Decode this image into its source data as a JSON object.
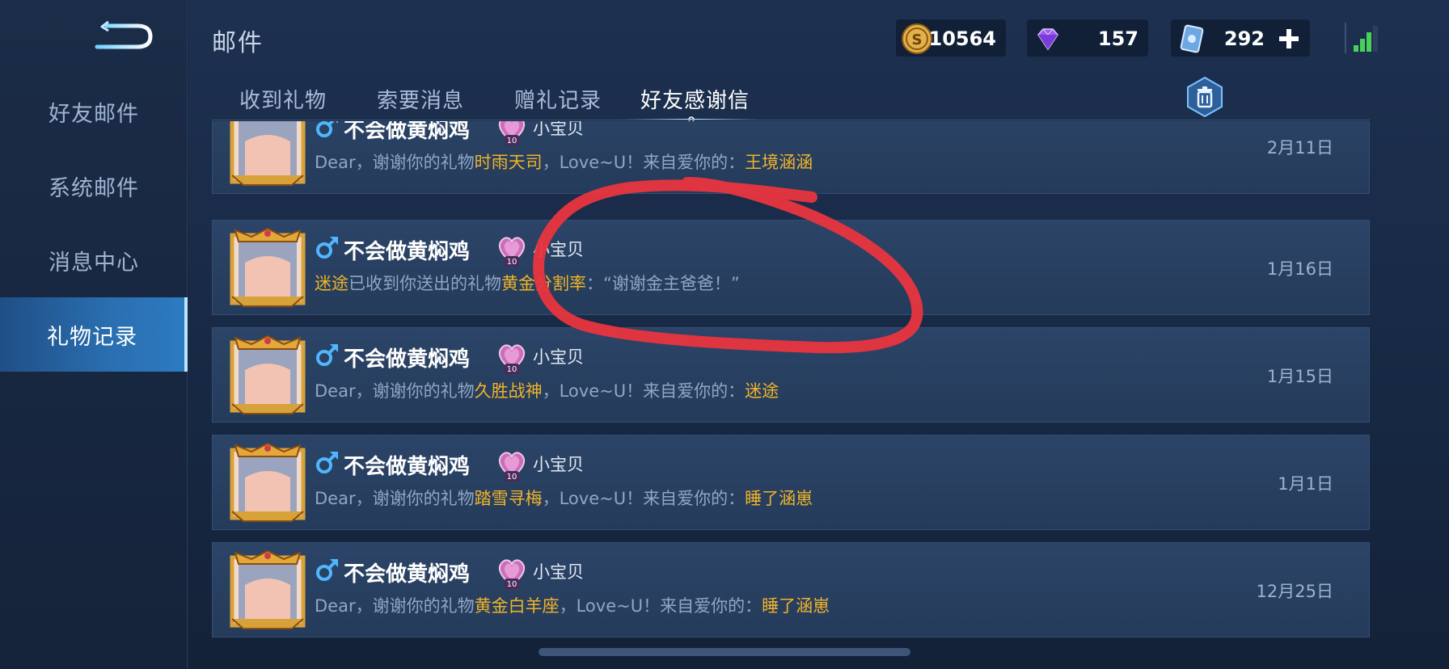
{
  "app": {
    "title": "邮件"
  },
  "sidebar": {
    "items": [
      {
        "label": "好友邮件",
        "active": false
      },
      {
        "label": "系统邮件",
        "active": false
      },
      {
        "label": "消息中心",
        "active": false
      },
      {
        "label": "礼物记录",
        "active": true
      }
    ]
  },
  "currencies": {
    "gold": {
      "icon": "gold-coin-icon",
      "value": "10564"
    },
    "diamond": {
      "icon": "purple-diamond-icon",
      "value": "157"
    },
    "card": {
      "icon": "blue-card-icon",
      "value": "292",
      "add_icon": "plus-icon"
    }
  },
  "tabs": [
    {
      "label": "收到礼物",
      "active": false
    },
    {
      "label": "索要消息",
      "active": false
    },
    {
      "label": "赠礼记录",
      "active": false
    },
    {
      "label": "好友感谢信",
      "active": true
    }
  ],
  "colors": {
    "highlight": "#f0b429",
    "active_nav": "#2a6fb0",
    "annotation": "#e8353f"
  },
  "messages": [
    {
      "sender": "不会做黄焖鸡",
      "relation_level": "10",
      "relation": "小宝贝",
      "parts": [
        {
          "text": "Dear，谢谢你的礼物",
          "hl": false
        },
        {
          "text": "时雨天司",
          "hl": true
        },
        {
          "text": "，Love~U！来自爱你的：",
          "hl": false
        },
        {
          "text": "王境涵涵",
          "hl": true
        }
      ],
      "date": "2月11日"
    },
    {
      "sender": "不会做黄焖鸡",
      "relation_level": "10",
      "relation": "小宝贝",
      "parts": [
        {
          "text": "迷途",
          "hl": true
        },
        {
          "text": "已收到你送出的礼物",
          "hl": false
        },
        {
          "text": "黄金分割率",
          "hl": true
        },
        {
          "text": "：“谢谢金主爸爸！”",
          "hl": false
        }
      ],
      "date": "1月16日"
    },
    {
      "sender": "不会做黄焖鸡",
      "relation_level": "10",
      "relation": "小宝贝",
      "parts": [
        {
          "text": "Dear，谢谢你的礼物",
          "hl": false
        },
        {
          "text": "久胜战神",
          "hl": true
        },
        {
          "text": "，Love~U！来自爱你的：",
          "hl": false
        },
        {
          "text": "迷途",
          "hl": true
        }
      ],
      "date": "1月15日"
    },
    {
      "sender": "不会做黄焖鸡",
      "relation_level": "10",
      "relation": "小宝贝",
      "parts": [
        {
          "text": "Dear，谢谢你的礼物",
          "hl": false
        },
        {
          "text": "踏雪寻梅",
          "hl": true
        },
        {
          "text": "，Love~U！来自爱你的：",
          "hl": false
        },
        {
          "text": "睡了涵崽",
          "hl": true
        }
      ],
      "date": "1月1日"
    },
    {
      "sender": "不会做黄焖鸡",
      "relation_level": "10",
      "relation": "小宝贝",
      "parts": [
        {
          "text": "Dear，谢谢你的礼物",
          "hl": false
        },
        {
          "text": "黄金白羊座",
          "hl": true
        },
        {
          "text": "，Love~U！来自爱你的：",
          "hl": false
        },
        {
          "text": "睡了涵崽",
          "hl": true
        }
      ],
      "date": "12月25日"
    }
  ]
}
